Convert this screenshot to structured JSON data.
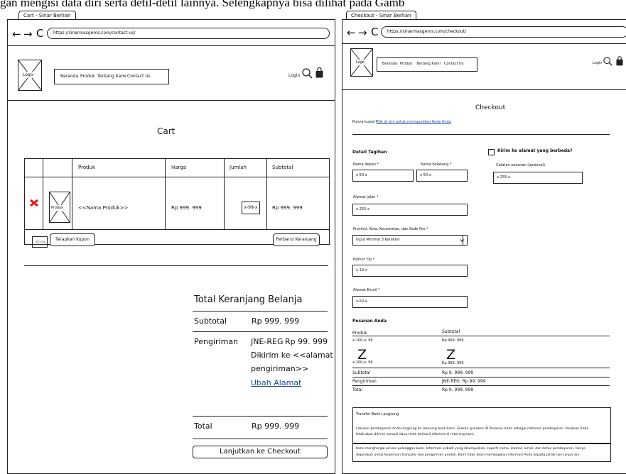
{
  "caption": "gan mengisi data diri serta detil-detil lainnya. Selengkapnya bisa dilihat pada Gamb",
  "cart": {
    "tab_title": "Cart - Sinar Berlian",
    "nav": {
      "back": "←",
      "forward": "→",
      "reload": "C"
    },
    "url": "https://sinarmasgems.com/contact-us/",
    "logo": "Logo",
    "menu": [
      "Beranda",
      "Produk",
      "Tentang Kami",
      "Contact Us"
    ],
    "login": "Login",
    "page_title": "Cart",
    "table_headers": [
      "Produk",
      "Harga",
      "Jumlah",
      "Subtotal"
    ],
    "row": {
      "product_thumb": "Produk",
      "name": "<<Nama Produk>>",
      "price": "Rp 999. 999",
      "qty": "x-99-x",
      "subtotal": "Rp 999. 999"
    },
    "coupon_placeholder": "Kode",
    "apply_coupon": "Terapkan Kupon",
    "update_cart": "Perbarui Keranjang",
    "totals": {
      "title": "Total Keranjang Belanja",
      "subtotal_label": "Subtotal",
      "subtotal_value": "Rp 999. 999",
      "shipping_label": "Pengiriman",
      "shipping_method": "JNE-REG",
      "shipping_price": "Rp 99. 999",
      "shipping_dest_1": "Dikirim ke <<alamat",
      "shipping_dest_2": "pengiriman>>",
      "change_address": "Ubah Alamat",
      "total_label": "Total",
      "total_value": "Rp 999. 999",
      "checkout_button": "Lanjutkan ke Checkout"
    }
  },
  "checkout": {
    "tab_title": "Checkout - Sinar Berlian",
    "nav": {
      "back": "←",
      "forward": "→",
      "reload": "C"
    },
    "url": "https://sinarmasgems.com/checkout/",
    "logo": "Logo",
    "menu": [
      "Beranda",
      "Produk",
      "Tentang Kami",
      "Contact Us"
    ],
    "login": "Login",
    "page_title": "Checkout",
    "coupon_text": "Punya kupon?",
    "coupon_link": "Klik di sini untuk memasukkan Kode Anda",
    "billing_title": "Detail Tagihan",
    "first_name_label": "Nama depan *",
    "first_name_value": "x-50-x",
    "last_name_label": "Nama belakang *",
    "last_name_value": "x-50-x",
    "address_label": "Alamat jalan *",
    "address_value": "x-255-x",
    "region_label": "Provinsi, Kota, Kecamatan, dan Kode Pos *",
    "region_value": "Input Minimal 3 Karakter",
    "phone_label": "Nomor Tlp *",
    "phone_value": "x-13-x",
    "email_label": "Alamat Email *",
    "email_value": "x-50-x",
    "ship_diff_label": "Kirim ke alamat yang berbeda?",
    "notes_label": "Catatan pesanan (opsional)",
    "notes_value": "x-255-x",
    "order_title": "Pesanan Anda",
    "order_headers": [
      "Produk",
      "Subtotal"
    ],
    "order_rows": [
      {
        "product": "x-100-x, 99",
        "subtotal": "Rp 999. 999"
      },
      {
        "product": "x-100-x, 99",
        "subtotal": "Rp 999. 999"
      }
    ],
    "z_mark": "Z",
    "summary": [
      {
        "label": "Subtotal",
        "value": "Rp 9. 999. 999"
      },
      {
        "label": "Pengiriman",
        "value": "JNE-REG: Rp 99. 999"
      },
      {
        "label": "Total",
        "value": "Rp 9. 999. 999"
      }
    ],
    "payment_title": "Transfer Bank Langsung",
    "payment_desc_1": "Lakukan pembayaran Anda langsung ke rekening bank kami. Silakan gunakan ID Pesanan Anda sebagai referensi pembayaran. Pesanan Anda",
    "payment_desc_2": "tidak akan dikirim sampai dana telah berhasil diterima di rekening kami.",
    "privacy_1": "Kami menghargai privasi pelanggan kami. Informasi pribadi yang dikumpulkan, seperti nama, alamat, email, dan detail pembayaran, hanya",
    "privacy_2": "digunakan untuk keperluan transaksi dan pengiriman produk. Kami tidak akan membagikan informasi Anda kepada pihak lain tanpa izin."
  },
  "colors": {
    "remove_icon": "#e02020",
    "link": "#1a4fa3"
  },
  "icons": [
    "search-icon",
    "shopping-bag-icon",
    "remove-item-icon",
    "chevron-down-icon",
    "checkbox-icon"
  ]
}
